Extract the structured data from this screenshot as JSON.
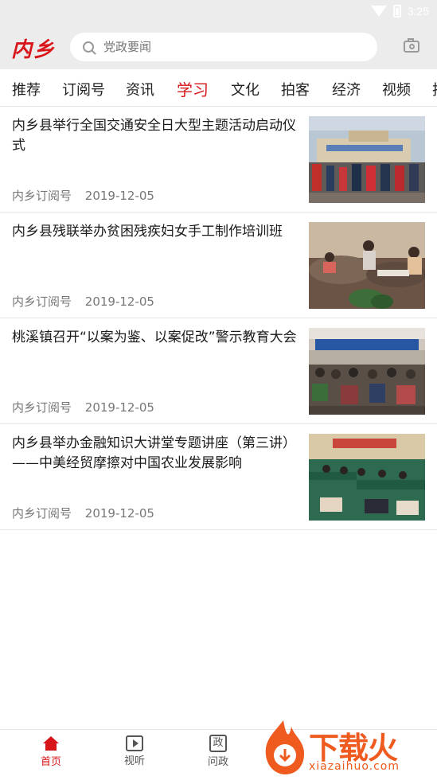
{
  "status": {
    "time": "3:25"
  },
  "header": {
    "logo": "内乡",
    "search_placeholder": "党政要闻"
  },
  "tabs": [
    {
      "label": "推荐",
      "active": false
    },
    {
      "label": "订阅号",
      "active": false
    },
    {
      "label": "资讯",
      "active": false
    },
    {
      "label": "学习",
      "active": true
    },
    {
      "label": "文化",
      "active": false
    },
    {
      "label": "拍客",
      "active": false
    },
    {
      "label": "经济",
      "active": false
    },
    {
      "label": "视频",
      "active": false
    },
    {
      "label": "拍",
      "active": false
    }
  ],
  "articles": [
    {
      "title": "内乡县举行全国交通安全日大型主题活动启动仪式",
      "source": "内乡订阅号",
      "date": "2019-12-05"
    },
    {
      "title": "内乡县残联举办贫困残疾妇女手工制作培训班",
      "source": "内乡订阅号",
      "date": "2019-12-05"
    },
    {
      "title": "桃溪镇召开“以案为鉴、以案促改”警示教育大会",
      "source": "内乡订阅号",
      "date": "2019-12-05"
    },
    {
      "title": "内乡县举办金融知识大讲堂专题讲座（第三讲）——中美经贸摩擦对中国农业发展影响",
      "source": "内乡订阅号",
      "date": "2019-12-05"
    }
  ],
  "bottom_nav": [
    {
      "label": "首页",
      "icon": "home-icon",
      "active": true
    },
    {
      "label": "视听",
      "icon": "tv-icon",
      "active": false
    },
    {
      "label": "问政",
      "icon": "gov-icon",
      "active": false,
      "icon_text": "政"
    }
  ],
  "watermark": {
    "brand": "下载火",
    "domain": "xiazaihuo.com"
  },
  "colors": {
    "accent": "#d8161a",
    "watermark": "#ef5a1f"
  }
}
